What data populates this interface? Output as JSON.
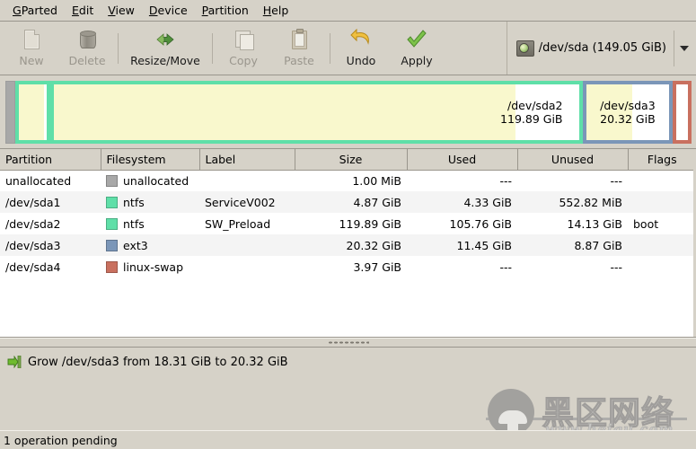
{
  "window": {
    "app_name": "GParted"
  },
  "menubar": {
    "items": [
      {
        "label": "GParted",
        "mnemonic": "G"
      },
      {
        "label": "Edit",
        "mnemonic": "E"
      },
      {
        "label": "View",
        "mnemonic": "V"
      },
      {
        "label": "Device",
        "mnemonic": "D"
      },
      {
        "label": "Partition",
        "mnemonic": "P"
      },
      {
        "label": "Help",
        "mnemonic": "H"
      }
    ]
  },
  "toolbar": {
    "buttons": [
      {
        "label": "New",
        "icon": "new-document-icon",
        "enabled": false
      },
      {
        "label": "Delete",
        "icon": "trash-can-icon",
        "enabled": false
      },
      {
        "label": "Resize/Move",
        "icon": "resize-move-arrows-icon",
        "enabled": true
      },
      {
        "label": "Copy",
        "icon": "copy-pages-icon",
        "enabled": false
      },
      {
        "label": "Paste",
        "icon": "clipboard-paste-icon",
        "enabled": false
      },
      {
        "label": "Undo",
        "icon": "undo-arrow-icon",
        "enabled": true
      },
      {
        "label": "Apply",
        "icon": "green-check-icon",
        "enabled": true
      }
    ],
    "device_selector": {
      "icon": "hard-disk-icon",
      "value": "/dev/sda  (149.05 GiB)",
      "dropdown_icon": "chevron-down-icon"
    }
  },
  "disk_graphic": {
    "segments": [
      {
        "name": "unallocated",
        "title": "",
        "size_label": "",
        "width_pct": 1.5,
        "border_color": "#9d9d9d",
        "body_color": "#a8a8a8",
        "used_pct": 0,
        "type": "unallocated",
        "show_text": false
      },
      {
        "name": "/dev/sda1",
        "title": "",
        "size_label": "",
        "width_pct": 5.1,
        "border_color": "#5fdfa8",
        "body_color": "#ffffff",
        "used_pct": 89,
        "type": "ntfs",
        "show_text": false
      },
      {
        "name": "/dev/sda2",
        "title": "/dev/sda2",
        "size_label": "119.89 GiB",
        "width_pct": 77.5,
        "border_color": "#5fdfa8",
        "body_color": "#ffffff",
        "used_pct": 88,
        "type": "ntfs",
        "show_text": true
      },
      {
        "name": "/dev/sda3",
        "title": "/dev/sda3",
        "size_label": "20.32 GiB",
        "width_pct": 13.2,
        "border_color": "#7b96b8",
        "body_color": "#ffffff",
        "used_pct": 56,
        "type": "ext3",
        "show_text": true
      },
      {
        "name": "/dev/sda4",
        "title": "",
        "size_label": "",
        "width_pct": 2.7,
        "border_color": "#c9705f",
        "body_color": "#ffffff",
        "used_pct": 0,
        "type": "linux-swap",
        "show_text": false
      }
    ]
  },
  "table": {
    "columns": [
      {
        "key": "partition",
        "label": "Partition",
        "align": "left"
      },
      {
        "key": "filesystem",
        "label": "Filesystem",
        "align": "left"
      },
      {
        "key": "label",
        "label": "Label",
        "align": "left"
      },
      {
        "key": "size",
        "label": "Size",
        "align": "center"
      },
      {
        "key": "used",
        "label": "Used",
        "align": "center"
      },
      {
        "key": "unused",
        "label": "Unused",
        "align": "center"
      },
      {
        "key": "flags",
        "label": "Flags",
        "align": "center"
      }
    ],
    "rows": [
      {
        "partition": "unallocated",
        "filesystem": "unallocated",
        "swatch": "#a8a8a8",
        "label": "",
        "size": "1.00 MiB",
        "used": "---",
        "unused": "---",
        "flags": ""
      },
      {
        "partition": "/dev/sda1",
        "filesystem": "ntfs",
        "swatch": "#5fdfa8",
        "label": "ServiceV002",
        "size": "4.87 GiB",
        "used": "4.33 GiB",
        "unused": "552.82 MiB",
        "flags": ""
      },
      {
        "partition": "/dev/sda2",
        "filesystem": "ntfs",
        "swatch": "#5fdfa8",
        "label": "SW_Preload",
        "size": "119.89 GiB",
        "used": "105.76 GiB",
        "unused": "14.13 GiB",
        "flags": "boot"
      },
      {
        "partition": "/dev/sda3",
        "filesystem": "ext3",
        "swatch": "#7b96b8",
        "label": "",
        "size": "20.32 GiB",
        "used": "11.45 GiB",
        "unused": "8.87 GiB",
        "flags": ""
      },
      {
        "partition": "/dev/sda4",
        "filesystem": "linux-swap",
        "swatch": "#c9705f",
        "label": "",
        "size": "3.97 GiB",
        "used": "---",
        "unused": "---",
        "flags": ""
      }
    ]
  },
  "operations": {
    "items": [
      {
        "icon": "grow-partition-arrow-icon",
        "text": "Grow /dev/sda3 from 18.31 GiB to 20.32 GiB"
      }
    ]
  },
  "statusbar": {
    "text": "1 operation pending"
  },
  "watermark": {
    "chinese": "黑区网络",
    "url": "www.heiqu.com",
    "logo_icon": "mushroom-logo-icon"
  },
  "colors": {
    "chrome": "#d6d2c8",
    "ntfs": "#5fdfa8",
    "ext3": "#7b96b8",
    "linux_swap": "#c9705f",
    "unallocated": "#a8a8a8",
    "used_fill": "#f9f8cd"
  }
}
